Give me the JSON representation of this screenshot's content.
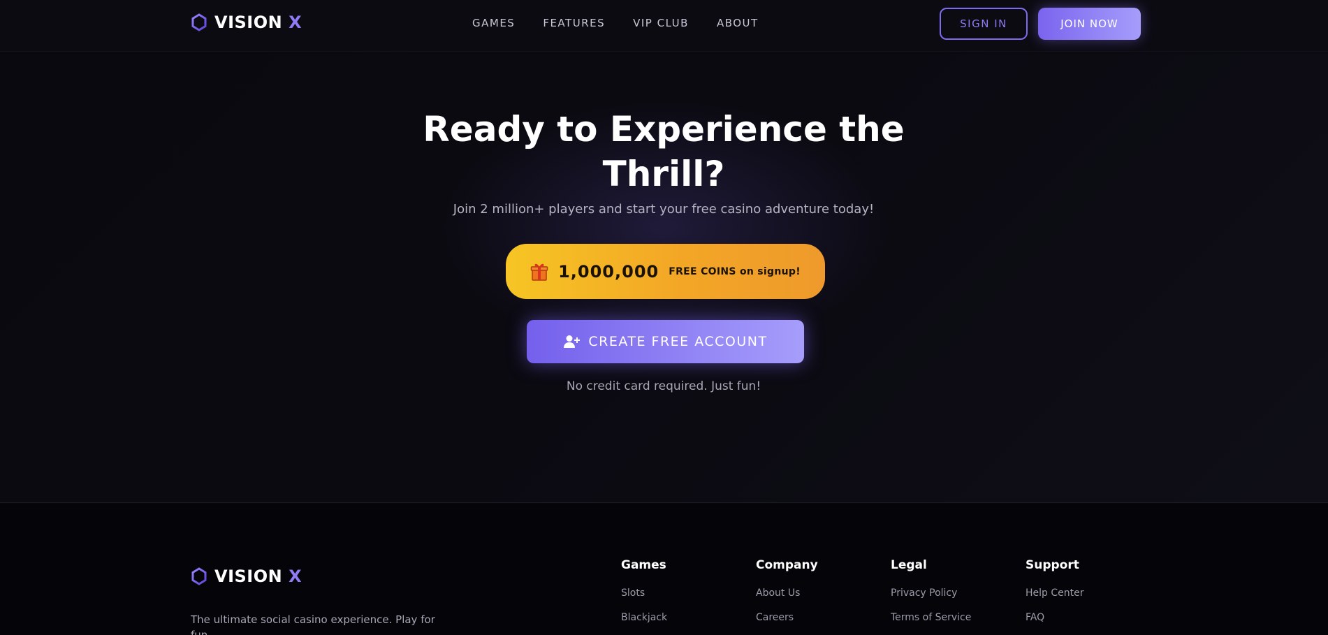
{
  "brand": {
    "name": "VISION",
    "x": "X",
    "accent": "#8f7cf5"
  },
  "nav": {
    "links": [
      "GAMES",
      "FEATURES",
      "VIP CLUB",
      "ABOUT"
    ],
    "sign_in": "SIGN IN",
    "join_now": "JOIN NOW"
  },
  "hero": {
    "title": "Ready to Experience the Thrill?",
    "subtitle": "Join 2 million+ players and start your free casino adventure today!",
    "coins_amount": "1,000,000",
    "coins_text": "FREE COINS on signup!",
    "cta": "CREATE FREE ACCOUNT",
    "note": "No credit card required. Just fun!"
  },
  "footer": {
    "description": "The ultimate social casino experience. Play for fun,",
    "columns": [
      {
        "title": "Games",
        "links": [
          "Slots",
          "Blackjack"
        ]
      },
      {
        "title": "Company",
        "links": [
          "About Us",
          "Careers"
        ]
      },
      {
        "title": "Legal",
        "links": [
          "Privacy Policy",
          "Terms of Service"
        ]
      },
      {
        "title": "Support",
        "links": [
          "Help Center",
          "FAQ"
        ]
      }
    ]
  },
  "icons": {
    "logo": "hexagon-icon",
    "coins": "gift-icon",
    "cta": "user-plus-icon"
  }
}
